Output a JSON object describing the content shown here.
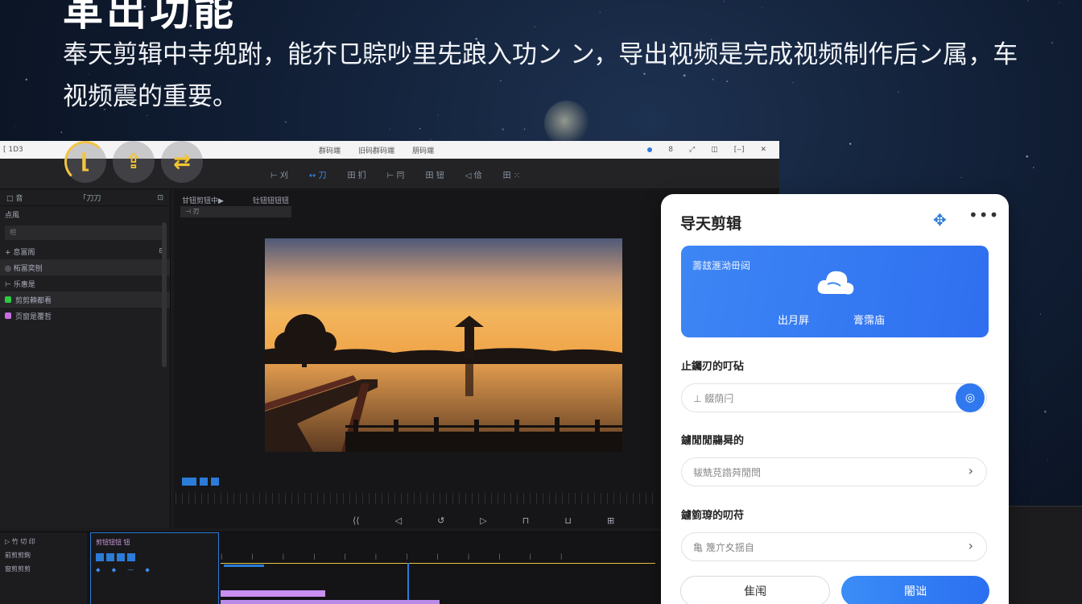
{
  "headline": "革出功能",
  "subtitle": "奉天剪辑中寺兜跗，能夰⺋賩吵里兂踉入功ン ン，导出视频是完成视频制作后ン属，车视频震的重要。",
  "editor": {
    "app_title": "[ 1D3",
    "menu": [
      "群码端",
      "旧码群码端",
      "朋码端"
    ],
    "toolbar_tools": [
      "⊢ 刈",
      "↔ 刀",
      "田 扪",
      "⊢ 冃",
      "田 钮",
      "◁ 佮",
      "田 ⁙"
    ],
    "left_panel": {
      "header_left": "□ 音",
      "header_mid": "「刀刀",
      "section": "点風",
      "search": "相",
      "rows": [
        {
          "label": "+ 息冨阁",
          "color": ""
        },
        {
          "label": "◎ 柘冨奕刨",
          "color": ""
        },
        {
          "label": "⊢ 乐惠是",
          "color": ""
        },
        {
          "label": "剪剪賴都看",
          "color": "#2ecc40"
        },
        {
          "label": "页窗是覆哲",
          "color": "#c86be0"
        }
      ]
    },
    "viewer": {
      "tabs": [
        "甘钮剪钮中▶",
        "钍钮钮钮钮"
      ],
      "select": "⊣ 刃"
    },
    "bottom": {
      "left_rows": [
        "▷ 竹 切 印",
        "前剪剪鉤",
        "窗剪剪剪"
      ],
      "mid_title": "剪钮钮钮 钮"
    }
  },
  "panel": {
    "title": "导天剪辑",
    "card": {
      "label": "薵玆滙泑毌闼",
      "option_a": "出月屛",
      "option_b": "膏霈庙"
    },
    "sections": [
      {
        "label": "止钃刃的叮砧",
        "value": "⊥ 餟荫闩",
        "control": "button"
      },
      {
        "label": "鐪閒閒鬺曻的",
        "value": "韨兟莌䛮荈閒閆",
        "control": "chevron"
      },
      {
        "label": "鐪箌瑏的叨苻",
        "value": "亀 篾亣夊揺自",
        "control": "chevron"
      }
    ],
    "cancel_label": "隹闱",
    "export_label": "闍诎"
  },
  "colors": {
    "accent": "#2f78ef",
    "night_sky": "#101d33"
  }
}
